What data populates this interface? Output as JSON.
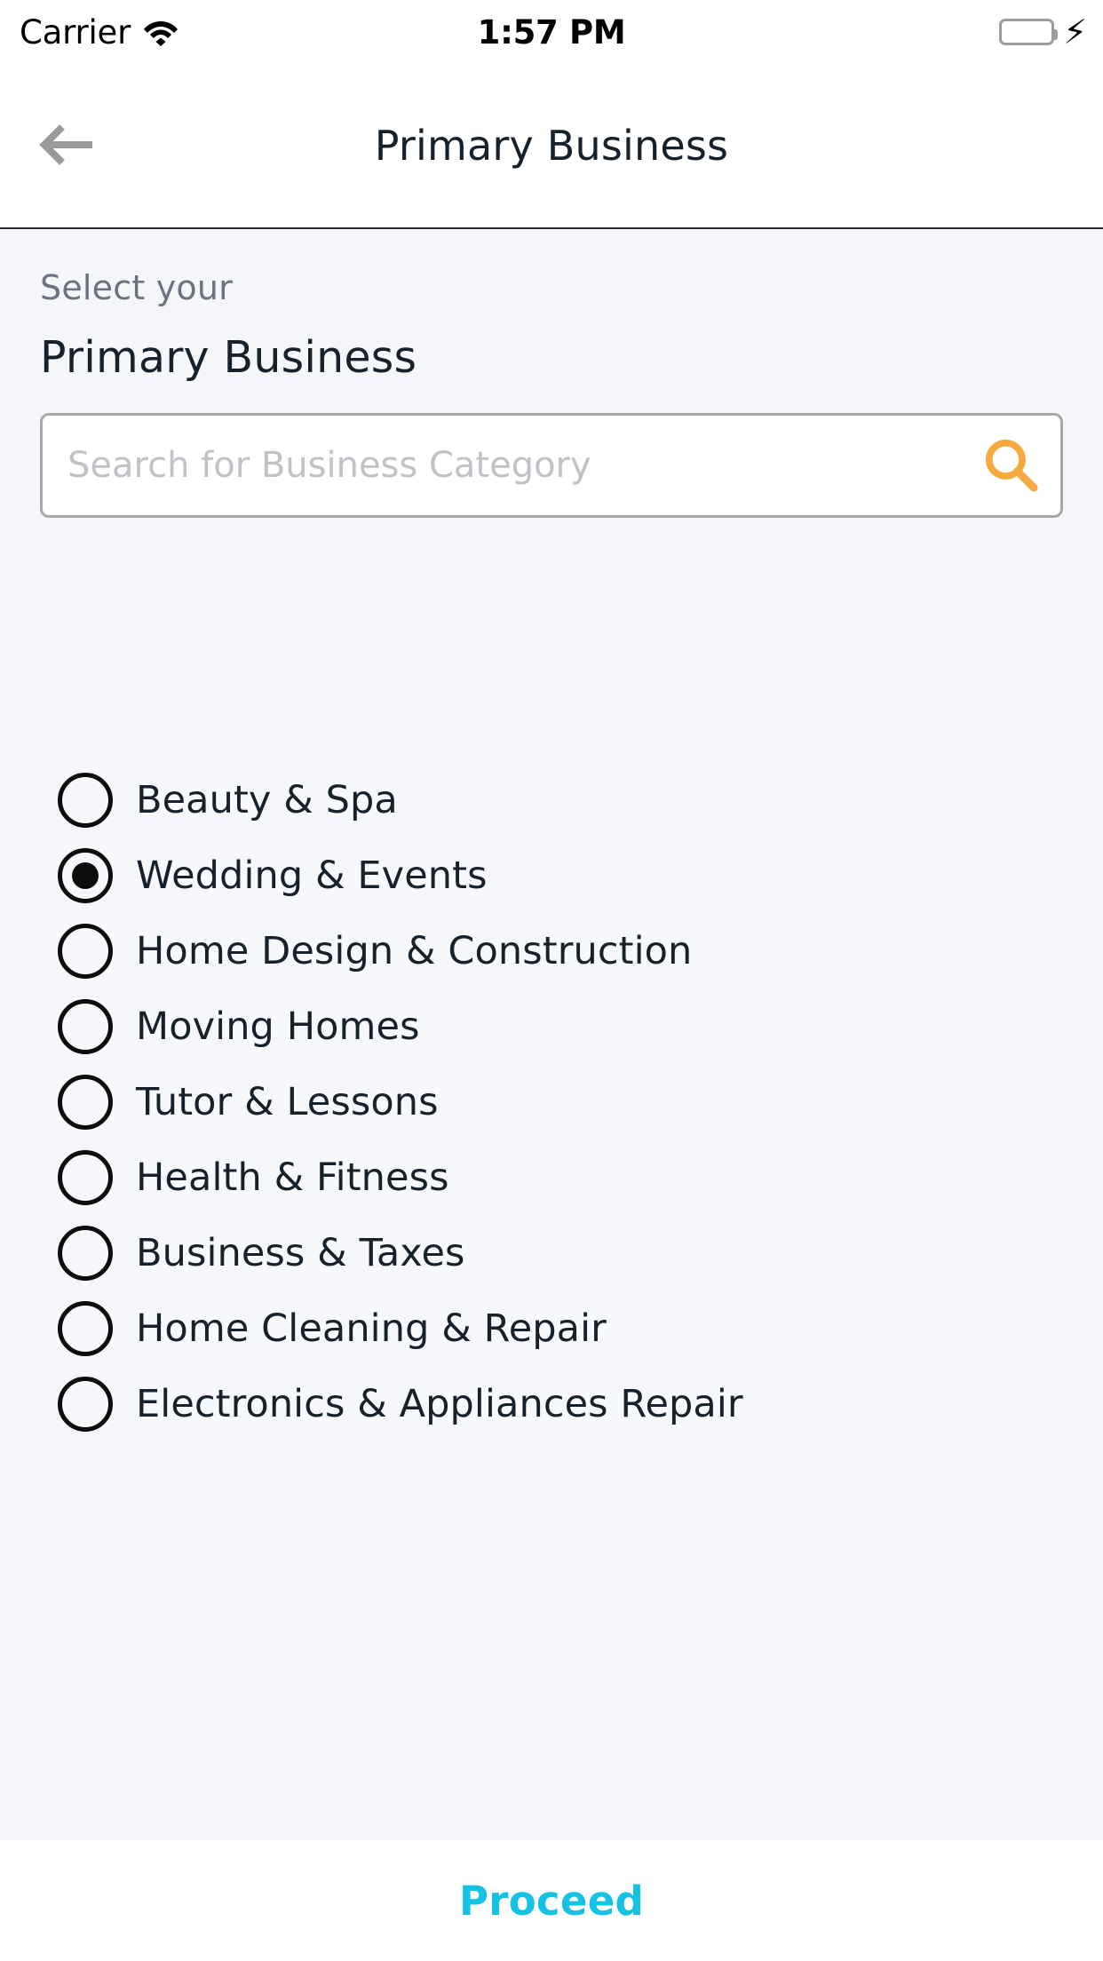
{
  "status_bar": {
    "carrier": "Carrier",
    "wifi_icon": "wifi-icon",
    "time": "1:57 PM",
    "battery_icon": "battery-icon",
    "battery_color": "#4CD964",
    "charging_icon": "lightning-bolt-icon"
  },
  "nav": {
    "back_icon": "arrow-left-icon",
    "title": "Primary Business"
  },
  "header": {
    "kicker": "Select your",
    "headline": "Primary Business"
  },
  "search": {
    "value": "",
    "placeholder": "Search for Business Category",
    "icon": "search-icon",
    "icon_color": "#F5A93F"
  },
  "options": [
    {
      "label": "Beauty & Spa",
      "selected": false
    },
    {
      "label": "Wedding & Events",
      "selected": true
    },
    {
      "label": "Home Design & Construction",
      "selected": false
    },
    {
      "label": "Moving Homes",
      "selected": false
    },
    {
      "label": "Tutor & Lessons",
      "selected": false
    },
    {
      "label": "Health & Fitness",
      "selected": false
    },
    {
      "label": "Business & Taxes",
      "selected": false
    },
    {
      "label": "Home Cleaning & Repair",
      "selected": false
    },
    {
      "label": "Electronics & Appliances Repair",
      "selected": false
    }
  ],
  "footer": {
    "proceed_label": "Proceed",
    "proceed_color": "#14c2e4"
  }
}
